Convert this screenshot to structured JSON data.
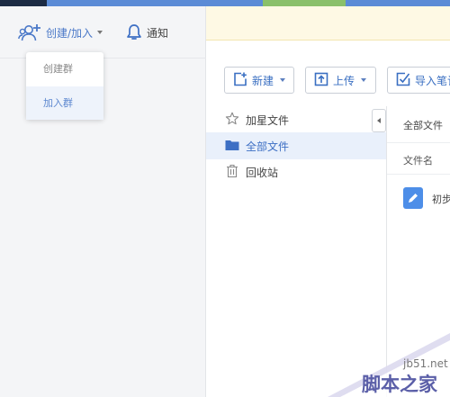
{
  "toolbar": {
    "create_join_label": "创建/加入",
    "notify_label": "通知"
  },
  "dropdown": {
    "items": [
      "创建群",
      "加入群"
    ]
  },
  "actions": {
    "new_label": "新建",
    "upload_label": "上传",
    "import_label": "导入笔记"
  },
  "nav": {
    "items": [
      "加星文件",
      "全部文件",
      "回收站"
    ]
  },
  "file_panel": {
    "breadcrumb": "全部文件",
    "column_name": "文件名",
    "rows": [
      {
        "name": "初步"
      }
    ]
  },
  "watermark": {
    "site": "jb51.net",
    "brand": "脚本之家"
  },
  "colors": {
    "accent": "#3d6fc4",
    "notice_bg": "#fef9e4",
    "sidebar_bg": "#f4f5f7",
    "selected_bg": "#e9f0fb",
    "doc_icon": "#4d8ee8"
  }
}
